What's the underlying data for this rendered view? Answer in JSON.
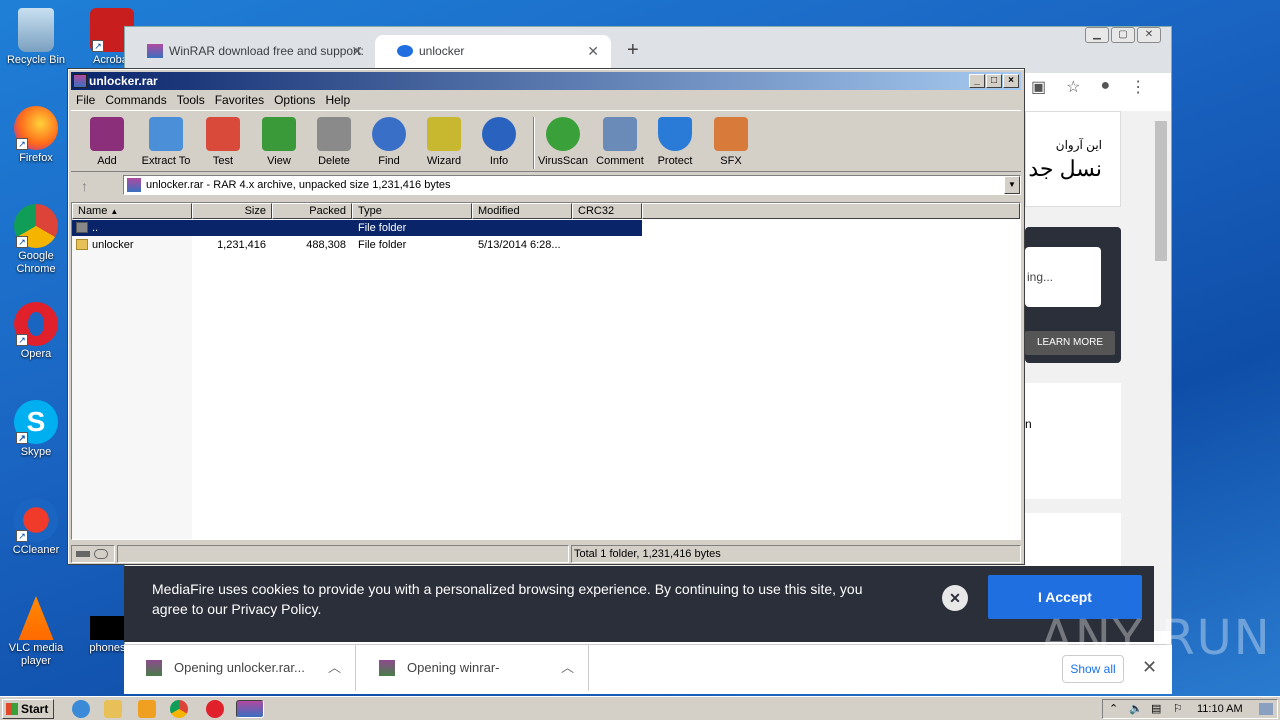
{
  "desktop": {
    "icons": [
      {
        "label": "Recycle Bin",
        "name": "recycle-bin"
      },
      {
        "label": "Firefox",
        "name": "firefox"
      },
      {
        "label": "Google Chrome",
        "name": "google-chrome"
      },
      {
        "label": "Opera",
        "name": "opera"
      },
      {
        "label": "Skype",
        "name": "skype"
      },
      {
        "label": "CCleaner",
        "name": "ccleaner"
      },
      {
        "label": "VLC media player",
        "name": "vlc"
      }
    ],
    "icon2_label": "Acrobat",
    "icon3_label": "phonestri"
  },
  "chrome": {
    "tabs": [
      {
        "label": "WinRAR download free and support:",
        "active": false
      },
      {
        "label": "unlocker",
        "active": true
      }
    ],
    "new_tab": "+"
  },
  "web": {
    "arabic1": "این آروان",
    "arabic2": "نسل جد",
    "loading_text": "ing...",
    "learn_more": "LEARN MORE",
    "n_text": "n"
  },
  "cookie": {
    "message": "MediaFire uses cookies to provide you with a personalized browsing experience. By continuing to use this site, you agree to our Privacy Policy.",
    "accept_label": "I Accept",
    "close_symbol": "✕"
  },
  "downloads": {
    "items": [
      "Opening unlocker.rar...",
      "Opening winrar-"
    ],
    "show_all": "Show all",
    "close": "✕"
  },
  "winrar": {
    "title": "unlocker.rar",
    "menu": [
      "File",
      "Commands",
      "Tools",
      "Favorites",
      "Options",
      "Help"
    ],
    "toolbar": [
      {
        "label": "Add",
        "color": "#8b2f7a"
      },
      {
        "label": "Extract To",
        "color": "#4a8fd8"
      },
      {
        "label": "Test",
        "color": "#d94a3a"
      },
      {
        "label": "View",
        "color": "#3a9a3a"
      },
      {
        "label": "Delete",
        "color": "#8a8a8a"
      },
      {
        "label": "Find",
        "color": "#3a6fc8"
      },
      {
        "label": "Wizard",
        "color": "#c8b830"
      },
      {
        "label": "Info",
        "color": "#2a62c0"
      },
      {
        "label": "VirusScan",
        "color": "#3aa03a"
      },
      {
        "label": "Comment",
        "color": "#6a8ab8"
      },
      {
        "label": "Protect",
        "color": "#2a7ad8"
      },
      {
        "label": "SFX",
        "color": "#d87a3a"
      }
    ],
    "address": "unlocker.rar - RAR 4.x archive, unpacked size 1,231,416 bytes",
    "columns": [
      "Name",
      "Size",
      "Packed",
      "Type",
      "Modified",
      "CRC32"
    ],
    "rows": [
      {
        "name": "..",
        "size": "",
        "packed": "",
        "type": "File folder",
        "modified": "",
        "crc": ""
      },
      {
        "name": "unlocker",
        "size": "1,231,416",
        "packed": "488,308",
        "type": "File folder",
        "modified": "5/13/2014 6:28...",
        "crc": ""
      }
    ],
    "status": "Total 1 folder, 1,231,416 bytes"
  },
  "taskbar": {
    "start": "Start",
    "clock": "11:10 AM"
  },
  "watermark": "ANY RUN"
}
